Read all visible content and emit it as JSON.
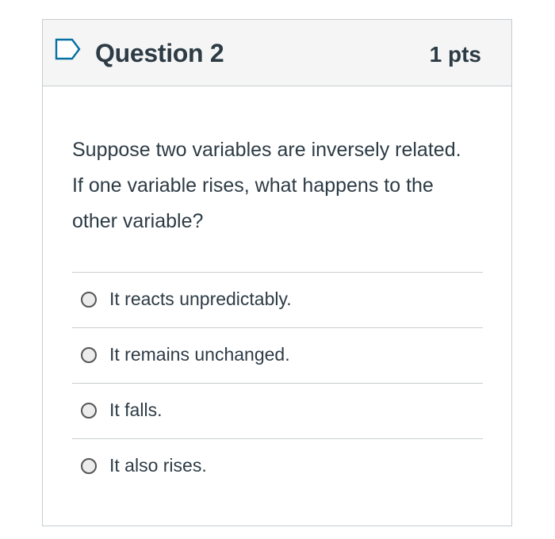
{
  "question": {
    "title": "Question 2",
    "points": "1 pts",
    "flag_icon": "flag-outline-icon",
    "prompt": "Suppose two variables are inversely related. If one variable rises, what happens to the other variable?"
  },
  "answers": [
    {
      "label": "It reacts unpredictably.",
      "selected": false
    },
    {
      "label": "It remains unchanged.",
      "selected": false
    },
    {
      "label": "It falls.",
      "selected": false
    },
    {
      "label": "It also rises.",
      "selected": false
    }
  ],
  "colors": {
    "header_bg": "#f5f5f5",
    "border": "#c7cdd1",
    "text": "#2d3b45",
    "flag_accent": "#0770a3"
  }
}
